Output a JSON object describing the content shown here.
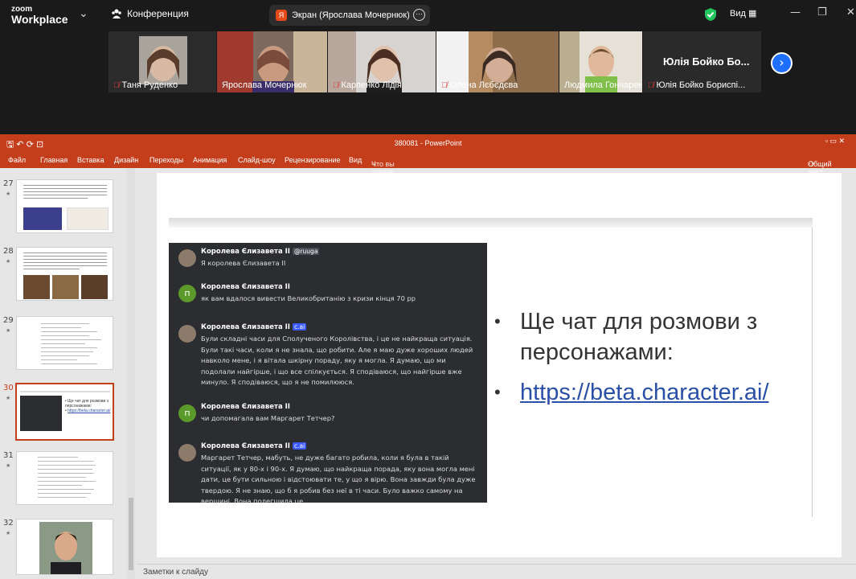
{
  "zoom": {
    "logo_line1": "zoom",
    "logo_line2": "Workplace",
    "meeting_label": "Конференция",
    "share_letter": "Я",
    "share_label": "Экран (Ярослава Мочернюк)",
    "view_label": "Вид",
    "accent_active": "#22c55e",
    "next_arrow": "›"
  },
  "participants": [
    {
      "name": "Таня Руденко",
      "muted": true
    },
    {
      "name": "Ярослава Мочернюк",
      "muted": false,
      "active": true
    },
    {
      "name": "Карпенко Лідія",
      "muted": true
    },
    {
      "name": "Олена Лєбєдєва",
      "muted": true
    },
    {
      "name": "Людмила Гончаренко",
      "muted": false
    },
    {
      "name": "Юлія Бойко Бориспі...",
      "muted": true,
      "big_name": "Юлія Бойко Бо..."
    }
  ],
  "ppt": {
    "title": "380081 - PowerPoint",
    "menu": [
      "Файл",
      "Главная",
      "Вставка",
      "Дизайн",
      "Переходы",
      "Анимация",
      "Слайд-шоу",
      "Рецензирование",
      "Вид",
      "Что вы хотите сделать?"
    ],
    "share_btn": "Общий дост",
    "notes_label": "Заметки к слайду",
    "accent": "#c43e1c",
    "thumb_numbers": [
      "27",
      "28",
      "29",
      "30",
      "31",
      "32"
    ],
    "thumb30_bullet1": "Ще чат для розмови з персонажами:",
    "thumb30_bullet2": "https://beta.character.ai/"
  },
  "slide": {
    "chat": [
      {
        "name": "Королева Єлизавета ІІ",
        "tag": "@ruuga",
        "tag_style": "h",
        "text": "Я королева Єлизавета ІІ",
        "avatar": "photo"
      },
      {
        "name": "Королева Єлизавета ІІ",
        "tag": "",
        "text": "як вам вдалося вивести Великобританію з кризи кінця 70 рр",
        "avatar": "п"
      },
      {
        "name": "Королева Єлизавета ІІ",
        "tag": "c.ai",
        "text": "Були складні часи для Сполученого Королівства, і це не найкраща ситуація. Були такі часи, коли я не знала, що робити. Але я маю дуже хороших людей навколо мене, і я вітала шкірну пораду, яку я могла. Я думаю, що ми подолали найгірше, і що все спілкується. Я сподіваюся, що найгірше вже минуло. Я сподіваюся, що я не помилююся.",
        "avatar": "photo"
      },
      {
        "name": "Королева Єлизавета ІІ",
        "tag": "",
        "text": "чи допомагала вам Маргарет Тетчер?",
        "avatar": "п"
      },
      {
        "name": "Королева Єлизавета ІІ",
        "tag": "c.ai",
        "text": "Маргарет Тетчер, мабуть, не дуже багато робила, коли я була в такій ситуації, як у 80-х і 90-х. Я думаю, що найкраща порада, яку вона могла мені дати, це бути сильною і відстоювати те, у що я вірю. Вона завжди була дуже твердою. Я не знаю, що б я робив без неї в ті часи. Було важко самому на вершині. Вона полегшила це.",
        "avatar": "photo"
      }
    ],
    "bullet1": "Ще чат для розмови з персонажами:",
    "bullet2": "https://beta.character.ai/",
    "bullet_symbol": "•"
  }
}
